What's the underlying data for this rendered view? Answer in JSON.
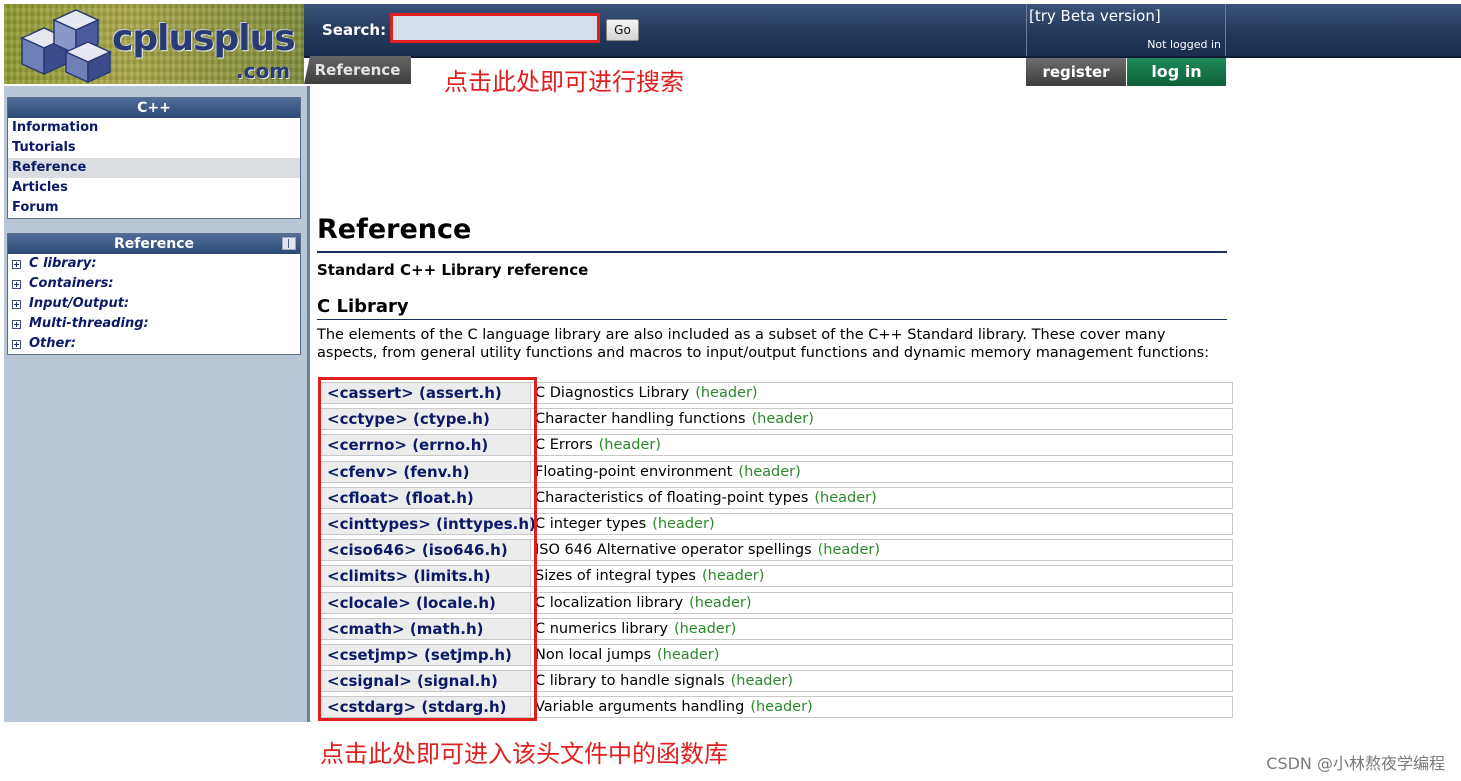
{
  "header": {
    "logo_text": "cplusplus",
    "logo_com": ".com",
    "search_label": "Search:",
    "search_value": "",
    "go_label": "Go",
    "beta_link": "[try Beta version]",
    "not_logged": "Not logged in",
    "tab_reference": "Reference",
    "register_label": "register",
    "login_label": "log in"
  },
  "annotations": {
    "search_note": "点击此处即可进行搜索",
    "table_note": "点击此处即可进入该头文件中的函数库",
    "watermark": "CSDN @小林熬夜学编程"
  },
  "sidebar": {
    "cpp_box_title": "C++",
    "cpp_items": [
      "Information",
      "Tutorials",
      "Reference",
      "Articles",
      "Forum"
    ],
    "active_item": "Reference",
    "ref_box_title": "Reference",
    "ref_items": [
      "C library:",
      "Containers:",
      "Input/Output:",
      "Multi-threading:",
      "Other:"
    ]
  },
  "main": {
    "title": "Reference",
    "subtitle": "Standard C++ Library reference",
    "section_title": "C Library",
    "intro": "The elements of the C language library are also included as a subset of the C++ Standard library. These cover many aspects, from general utility functions and macros to input/output functions and dynamic memory management functions:",
    "tag": "(header)",
    "libraries": [
      {
        "name": "<cassert> (assert.h)",
        "desc": "C Diagnostics Library"
      },
      {
        "name": "<cctype> (ctype.h)",
        "desc": "Character handling functions"
      },
      {
        "name": "<cerrno> (errno.h)",
        "desc": "C Errors"
      },
      {
        "name": "<cfenv> (fenv.h)",
        "desc": "Floating-point environment"
      },
      {
        "name": "<cfloat> (float.h)",
        "desc": "Characteristics of floating-point types"
      },
      {
        "name": "<cinttypes> (inttypes.h)",
        "desc": "C integer types"
      },
      {
        "name": "<ciso646> (iso646.h)",
        "desc": "ISO 646 Alternative operator spellings"
      },
      {
        "name": "<climits> (limits.h)",
        "desc": "Sizes of integral types"
      },
      {
        "name": "<clocale> (locale.h)",
        "desc": "C localization library"
      },
      {
        "name": "<cmath> (math.h)",
        "desc": "C numerics library"
      },
      {
        "name": "<csetjmp> (setjmp.h)",
        "desc": "Non local jumps"
      },
      {
        "name": "<csignal> (signal.h)",
        "desc": "C library to handle signals"
      },
      {
        "name": "<cstdarg> (stdarg.h)",
        "desc": "Variable arguments handling"
      }
    ]
  },
  "colors": {
    "header_blue": "#22395a",
    "link_navy": "#0b1a66",
    "annotation_red": "#e02020",
    "header_tag_green": "#2a8a2a",
    "login_green": "#0e6038"
  }
}
